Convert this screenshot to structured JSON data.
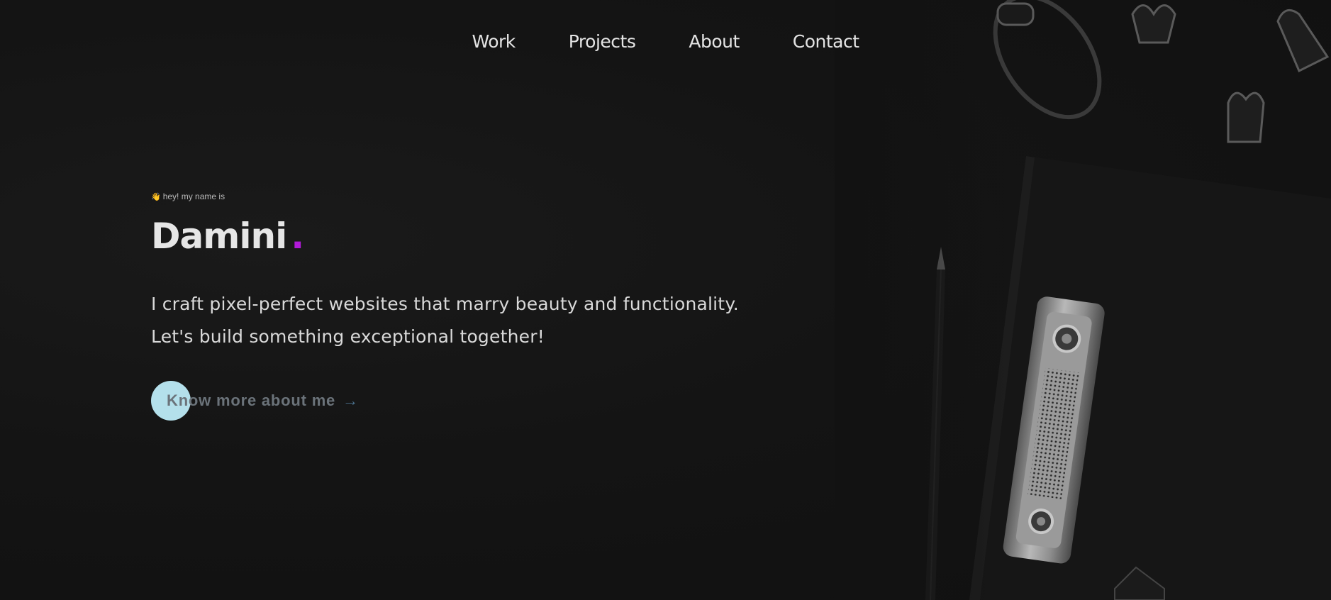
{
  "nav": {
    "items": [
      {
        "label": "Work"
      },
      {
        "label": "Projects"
      },
      {
        "label": "About"
      },
      {
        "label": "Contact"
      }
    ]
  },
  "hero": {
    "greeting_icon": "waving-hand-icon",
    "greeting_emoji": "👋",
    "greeting": "hey! my name is",
    "name": "Damini",
    "name_dot": ".",
    "tagline_line1": "I craft pixel-perfect websites that marry beauty and functionality.",
    "tagline_line2": "Let's build something exceptional together!",
    "cta_label": "Know more about me",
    "cta_arrow": "→"
  },
  "colors": {
    "background": "#121212",
    "accent_dot": "#b21ad9",
    "cta_circle": "#b4e0eb",
    "text_primary": "#e6e6e6"
  },
  "decor": {
    "background_photo": "desk-with-clipboard-pencil-glasses-paperclips"
  }
}
